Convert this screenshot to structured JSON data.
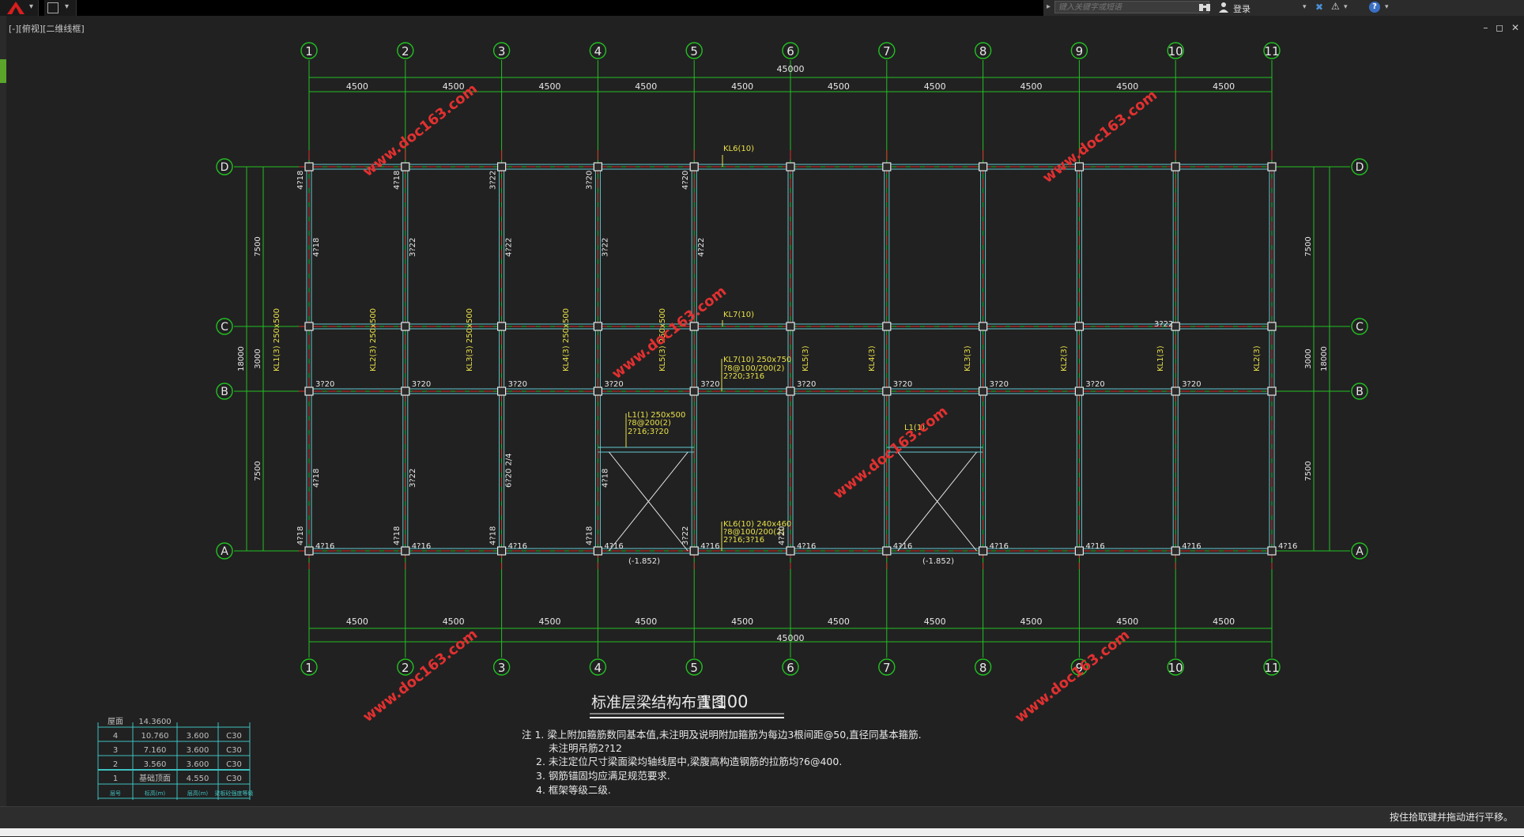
{
  "app": {
    "viewport_label": "[-][俯视][二维线框]",
    "search_placeholder": "键入关键字或短语",
    "login_label": "登录",
    "status_text": "按住拾取键并拖动进行平移。",
    "window_controls": [
      "–",
      "◻",
      "✕"
    ]
  },
  "drawing": {
    "title": "标准层梁结构布置图",
    "scale": "1:100",
    "watermark": "www.doc163.com",
    "column_axes": [
      "1",
      "2",
      "3",
      "4",
      "5",
      "6",
      "7",
      "8",
      "9",
      "10",
      "11"
    ],
    "row_axes": [
      "D",
      "C",
      "B",
      "A"
    ],
    "bay_dim": "4500",
    "total_dim": "45000",
    "row_spans": [
      "7500",
      "3000",
      "7500"
    ],
    "total_depth": "18000",
    "elevations": [
      "(-1.852)",
      "(-1.852)"
    ],
    "notes": [
      "注 1. 梁上附加箍筋数同基本值,未注明及说明附加箍筋为每边3根间距@50,直径同基本箍筋.",
      "未注明吊筋2?12",
      "2. 未注定位尺寸梁面梁均轴线居中,梁腹高构造钢筋的拉筋均?6@400.",
      "3. 钢筋锚固均应满足规范要求.",
      "4. 框架等级二级."
    ],
    "beam_labels": {
      "kl6_top": "KL6(10)",
      "kl7_top": "KL7(10)",
      "kl7_b1": "KL7(10) 250x750",
      "kl7_b2": "?8@100/200(2)",
      "kl7_b3": "2?20;3?16",
      "l1_1": "L1(1) 250x500",
      "l1_2": "?8@200(2)",
      "l1_3": "2?16;3?20",
      "kl6_b1": "KL6(10) 240x460",
      "kl6_b2": "?8@100/200(2)",
      "kl6_b3": "2?16;3?16",
      "l1_right": "L1(1)",
      "top_3122": "3?22",
      "v_labels": [
        "KL5(3)",
        "KL4(3)",
        "KL3(3)",
        "KL2(3)",
        "KL1(3)",
        "KL2(3)"
      ],
      "left_v1": "KL1(3) 250x500",
      "left_v2": "KL2(3) 250x500",
      "left_v3": "KL3(3) 250x500",
      "left_v4": "KL4(3) 250x500",
      "left_v5": "KL5(3) 250x500"
    },
    "rebar_top_row": [
      "4?18",
      "4?18",
      "3?22",
      "3?20",
      "4?20"
    ],
    "rebar_mid_v": [
      "4?18",
      "3?22",
      "4?22",
      "3?22",
      "4?22"
    ],
    "rebar_b_row": [
      "3?20",
      "3?20",
      "3?20",
      "3?20",
      "3?20",
      "3?20",
      "3?20",
      "3?20",
      "3?20",
      "3?20"
    ],
    "rebar_a_row": [
      "4?16",
      "4?16",
      "4?16",
      "4?16",
      "4?16",
      "4?16",
      "4?16",
      "4?16",
      "4?16",
      "4?16",
      "4?16"
    ],
    "rebar_lower_v": [
      "4?18",
      "3?22",
      "6?20 2/4",
      "4?18"
    ],
    "rebar_left_col": [
      "4?18",
      "4?18",
      "4?18",
      "4?18",
      "3?22",
      "4?20"
    ]
  },
  "legend_table": {
    "rows": [
      [
        "屋面",
        "14.3600",
        "",
        ""
      ],
      [
        "4",
        "10.760",
        "3.600",
        "C30"
      ],
      [
        "3",
        "7.160",
        "3.600",
        "C30"
      ],
      [
        "2",
        "3.560",
        "3.600",
        "C30"
      ],
      [
        "1",
        "基础顶面",
        "4.550",
        "C30"
      ]
    ],
    "header": [
      "层号",
      "标高(m)",
      "层高(m)",
      "梁板砼强度等级"
    ]
  },
  "colors": {
    "background": "#212121",
    "axis_green": "#22c022",
    "beam_cyan": "#63c7cf",
    "column_red": "#e02a2a",
    "label_yellow": "#e8e04a",
    "watermark_red": "#e23030",
    "text_white": "#e8e8e8"
  }
}
